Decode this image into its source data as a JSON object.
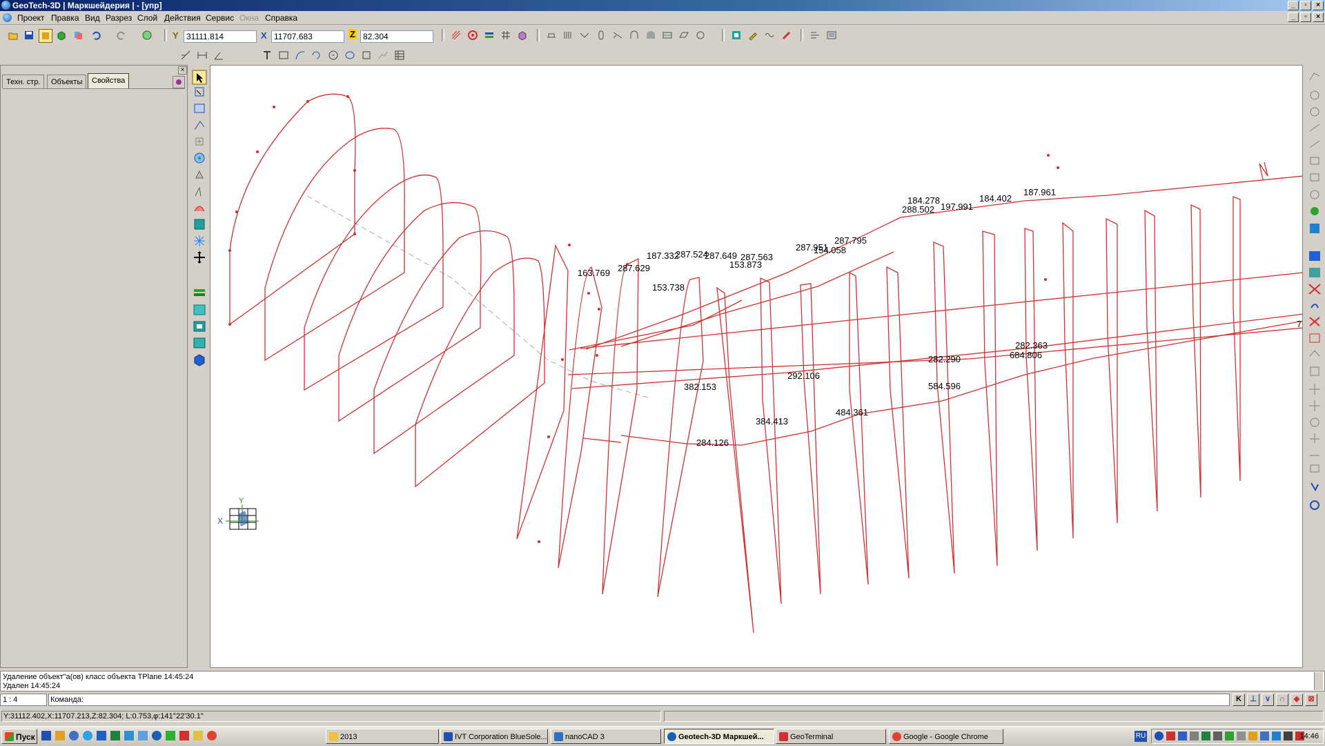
{
  "window": {
    "title": "GeoTech-3D | Маркшейдерия | - [упр]"
  },
  "menu": [
    "Проект",
    "Правка",
    "Вид",
    "Разрез",
    "Слой",
    "Действия",
    "Сервис",
    "Окна",
    "Справка"
  ],
  "coords": {
    "y_label": "Y",
    "y_value": "31111.814",
    "x_label": "X",
    "x_value": "11707.683",
    "z_label": "Z",
    "z_value": "82.304"
  },
  "panel_tabs": [
    "Техн. стр.",
    "Объекты",
    "Свойства"
  ],
  "active_tab": "Свойства",
  "drawing_labels": [
    "163.769",
    "287.629",
    "187.332",
    "287.524",
    "287.649",
    "287.563",
    "153.873",
    "287.951",
    "154.058",
    "287.795",
    "153.738",
    "184.278",
    "288.502",
    "197.991",
    "184.402",
    "187.961",
    "382.153",
    "292.106",
    "282.290",
    "282.363",
    "684.806",
    "584.596",
    "384.413",
    "484.361",
    "284.126",
    "7"
  ],
  "axis": {
    "x": "X",
    "y": "Y"
  },
  "log": [
    "Удаление объект\"а(ов) класс объекта TPlane 14:45:24",
    "Удален 14:45:24"
  ],
  "scale": "1 : 4",
  "command_label": "Команда:",
  "status_text": "Y:31112.402,X:11707.213,Z:82.304; L:0.753,φ:141°22'30.1\"",
  "taskbar": {
    "start": "Пуск",
    "tasks": [
      "2013",
      "IVT Corporation BlueSole...",
      "nanoCAD 3",
      "Geotech-3D Маркшей...",
      "GeoTerminal",
      "Google - Google Chrome"
    ],
    "active_task": "Geotech-3D Маркшей...",
    "lang": "RU",
    "clock": "14:46"
  },
  "colors": {
    "drawing": "#d03030",
    "axis_dash": "#aaaaaa",
    "title": "#0a246a"
  }
}
